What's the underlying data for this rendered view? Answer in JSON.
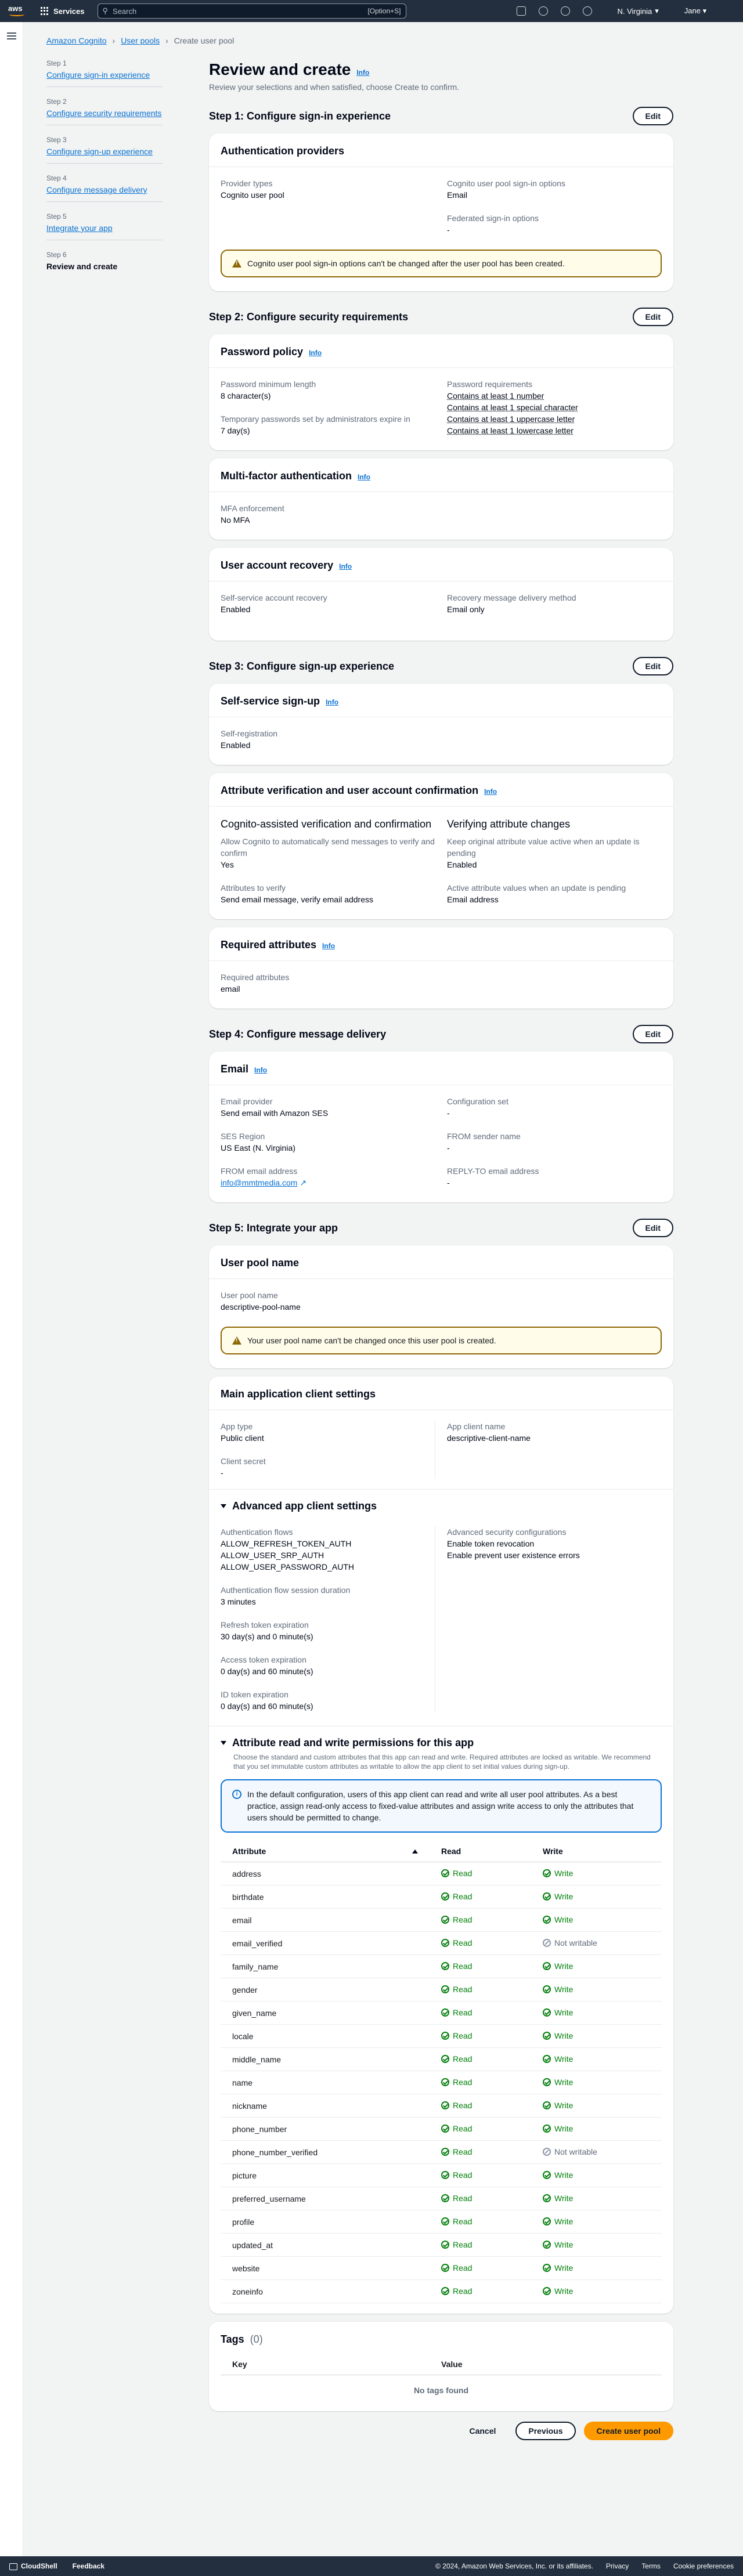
{
  "topnav": {
    "logo": "aws",
    "services": "Services",
    "search_placeholder": "Search",
    "search_shortcut": "[Option+S]",
    "region": "N. Virginia",
    "user": "Jane"
  },
  "breadcrumb": [
    "Amazon Cognito",
    "User pools",
    "Create user pool"
  ],
  "steps": [
    {
      "num": "Step 1",
      "label": "Configure sign-in experience"
    },
    {
      "num": "Step 2",
      "label": "Configure security requirements"
    },
    {
      "num": "Step 3",
      "label": "Configure sign-up experience"
    },
    {
      "num": "Step 4",
      "label": "Configure message delivery"
    },
    {
      "num": "Step 5",
      "label": "Integrate your app"
    },
    {
      "num": "Step 6",
      "label": "Review and create"
    }
  ],
  "page": {
    "title": "Review and create",
    "info": "Info",
    "desc": "Review your selections and when satisfied, choose Create to confirm.",
    "edit": "Edit"
  },
  "s1": {
    "title": "Step 1: Configure sign-in experience",
    "card_title": "Authentication providers",
    "provider_types_k": "Provider types",
    "provider_types_v": "Cognito user pool",
    "signin_k": "Cognito user pool sign-in options",
    "signin_v": "Email",
    "federated_k": "Federated sign-in options",
    "federated_v": "-",
    "alert": "Cognito user pool sign-in options can't be changed after the user pool has been created."
  },
  "s2": {
    "title": "Step 2: Configure security requirements",
    "pw_title": "Password policy",
    "pw_min_k": "Password minimum length",
    "pw_min_v": "8 character(s)",
    "temp_k": "Temporary passwords set by administrators expire in",
    "temp_v": "7 day(s)",
    "req_k": "Password requirements",
    "req_v": [
      "Contains at least 1 number",
      "Contains at least 1 special character",
      "Contains at least 1 uppercase letter",
      "Contains at least 1 lowercase letter"
    ],
    "mfa_title": "Multi-factor authentication",
    "mfa_k": "MFA enforcement",
    "mfa_v": "No MFA",
    "rec_title": "User account recovery",
    "rec_k": "Self-service account recovery",
    "rec_v": "Enabled",
    "rec_method_k": "Recovery message delivery method",
    "rec_method_v": "Email only"
  },
  "s3": {
    "title": "Step 3: Configure sign-up experience",
    "ss_title": "Self-service sign-up",
    "ss_k": "Self-registration",
    "ss_v": "Enabled",
    "av_title": "Attribute verification and user account confirmation",
    "av_left_h": "Cognito-assisted verification and confirmation",
    "av_left_k": "Allow Cognito to automatically send messages to verify and confirm",
    "av_left_v": "Yes",
    "av_attr_k": "Attributes to verify",
    "av_attr_v": "Send email message, verify email address",
    "av_right_h": "Verifying attribute changes",
    "av_keep_k": "Keep original attribute value active when an update is pending",
    "av_keep_v": "Enabled",
    "av_active_k": "Active attribute values when an update is pending",
    "av_active_v": "Email address",
    "ra_title": "Required attributes",
    "ra_k": "Required attributes",
    "ra_v": "email"
  },
  "s4": {
    "title": "Step 4: Configure message delivery",
    "card_title": "Email",
    "provider_k": "Email provider",
    "provider_v": "Send email with Amazon SES",
    "region_k": "SES Region",
    "region_v": "US East (N. Virginia)",
    "from_k": "FROM email address",
    "from_v": "info@mmtmedia.com",
    "config_k": "Configuration set",
    "config_v": "-",
    "sender_k": "FROM sender name",
    "sender_v": "-",
    "reply_k": "REPLY-TO email address",
    "reply_v": "-"
  },
  "s5": {
    "title": "Step 5: Integrate your app",
    "pool_title": "User pool name",
    "pool_k": "User pool name",
    "pool_v": "descriptive-pool-name",
    "pool_alert": "Your user pool name can't be changed once this user pool is created.",
    "client_title": "Main application client settings",
    "app_type_k": "App type",
    "app_type_v": "Public client",
    "secret_k": "Client secret",
    "secret_v": "-",
    "client_name_k": "App client name",
    "client_name_v": "descriptive-client-name",
    "adv_title": "Advanced app client settings",
    "flows_k": "Authentication flows",
    "flows_v": [
      "ALLOW_REFRESH_TOKEN_AUTH",
      "ALLOW_USER_SRP_AUTH",
      "ALLOW_USER_PASSWORD_AUTH"
    ],
    "session_k": "Authentication flow session duration",
    "session_v": "3 minutes",
    "refresh_k": "Refresh token expiration",
    "refresh_v": "30 day(s) and 0 minute(s)",
    "access_k": "Access token expiration",
    "access_v": "0 day(s) and 60 minute(s)",
    "id_k": "ID token expiration",
    "id_v": "0 day(s) and 60 minute(s)",
    "security_k": "Advanced security configurations",
    "security_v": [
      "Enable token revocation",
      "Enable prevent user existence errors"
    ],
    "perm_title": "Attribute read and write permissions for this app",
    "perm_desc": "Choose the standard and custom attributes that this app can read and write. Required attributes are locked as writable. We recommend that you set immutable custom attributes as writable to allow the app client to set initial values during sign-up.",
    "perm_alert": "In the default configuration, users of this app client can read and write all user pool attributes. As a best practice, assign read-only access to fixed-value attributes and assign write access to only the attributes that users should be permitted to change.",
    "col_attr": "Attribute",
    "col_read": "Read",
    "col_write": "Write",
    "rows": [
      {
        "name": "address",
        "read": "Read",
        "write": "Write"
      },
      {
        "name": "birthdate",
        "read": "Read",
        "write": "Write"
      },
      {
        "name": "email",
        "read": "Read",
        "write": "Write"
      },
      {
        "name": "email_verified",
        "read": "Read",
        "write": "Not writable"
      },
      {
        "name": "family_name",
        "read": "Read",
        "write": "Write"
      },
      {
        "name": "gender",
        "read": "Read",
        "write": "Write"
      },
      {
        "name": "given_name",
        "read": "Read",
        "write": "Write"
      },
      {
        "name": "locale",
        "read": "Read",
        "write": "Write"
      },
      {
        "name": "middle_name",
        "read": "Read",
        "write": "Write"
      },
      {
        "name": "name",
        "read": "Read",
        "write": "Write"
      },
      {
        "name": "nickname",
        "read": "Read",
        "write": "Write"
      },
      {
        "name": "phone_number",
        "read": "Read",
        "write": "Write"
      },
      {
        "name": "phone_number_verified",
        "read": "Read",
        "write": "Not writable"
      },
      {
        "name": "picture",
        "read": "Read",
        "write": "Write"
      },
      {
        "name": "preferred_username",
        "read": "Read",
        "write": "Write"
      },
      {
        "name": "profile",
        "read": "Read",
        "write": "Write"
      },
      {
        "name": "updated_at",
        "read": "Read",
        "write": "Write"
      },
      {
        "name": "website",
        "read": "Read",
        "write": "Write"
      },
      {
        "name": "zoneinfo",
        "read": "Read",
        "write": "Write"
      }
    ]
  },
  "tags": {
    "title": "Tags",
    "count": "(0)",
    "col_key": "Key",
    "col_value": "Value",
    "empty": "No tags found"
  },
  "actions": {
    "cancel": "Cancel",
    "previous": "Previous",
    "create": "Create user pool"
  },
  "footer": {
    "cloudshell": "CloudShell",
    "feedback": "Feedback",
    "copyright": "© 2024, Amazon Web Services, Inc. or its affiliates.",
    "privacy": "Privacy",
    "terms": "Terms",
    "cookies": "Cookie preferences"
  }
}
